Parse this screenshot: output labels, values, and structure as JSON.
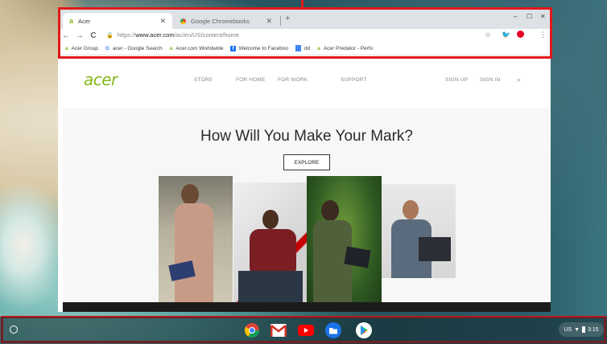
{
  "browser": {
    "tabs": [
      {
        "title": "Acer",
        "active": true
      },
      {
        "title": "Google Chromebooks",
        "active": false
      }
    ],
    "new_tab": "+",
    "window_controls": {
      "minimize": "–",
      "maximize": "☐",
      "close": "✕"
    },
    "toolbar": {
      "back": "←",
      "forward": "→",
      "reload": "C",
      "url_scheme": "https://",
      "url_host": "www.acer.com",
      "url_path": "/ac/en/US/content/home",
      "star": "☆",
      "menu": "⋮"
    },
    "bookmarks": [
      {
        "label": "Acer Group",
        "icon": "acer-icon"
      },
      {
        "label": "acer - Google Search",
        "icon": "google-icon"
      },
      {
        "label": "Acer.com Worldwide",
        "icon": "acer-icon"
      },
      {
        "label": "Welcome to Faceboo",
        "icon": "facebook-icon"
      },
      {
        "label": "dd",
        "icon": "doc-icon"
      },
      {
        "label": "Acer Predator - Perfo",
        "icon": "acer-icon"
      }
    ]
  },
  "site": {
    "logo": "acer",
    "nav": [
      "STORE",
      "FOR HOME",
      "FOR WORK",
      "SUPPORT"
    ],
    "account": [
      "SIGN UP",
      "SIGN IN"
    ],
    "hero_title": "How Will You Make Your Mark?",
    "cta": "EXPLORE"
  },
  "shelf": {
    "apps": [
      "chrome-icon",
      "gmail-icon",
      "youtube-icon",
      "files-icon",
      "play-store-icon"
    ],
    "status": {
      "locale": "US",
      "time": "3:15"
    }
  },
  "colors": {
    "highlight": "#e0191b",
    "acer_green": "#83b81a"
  }
}
